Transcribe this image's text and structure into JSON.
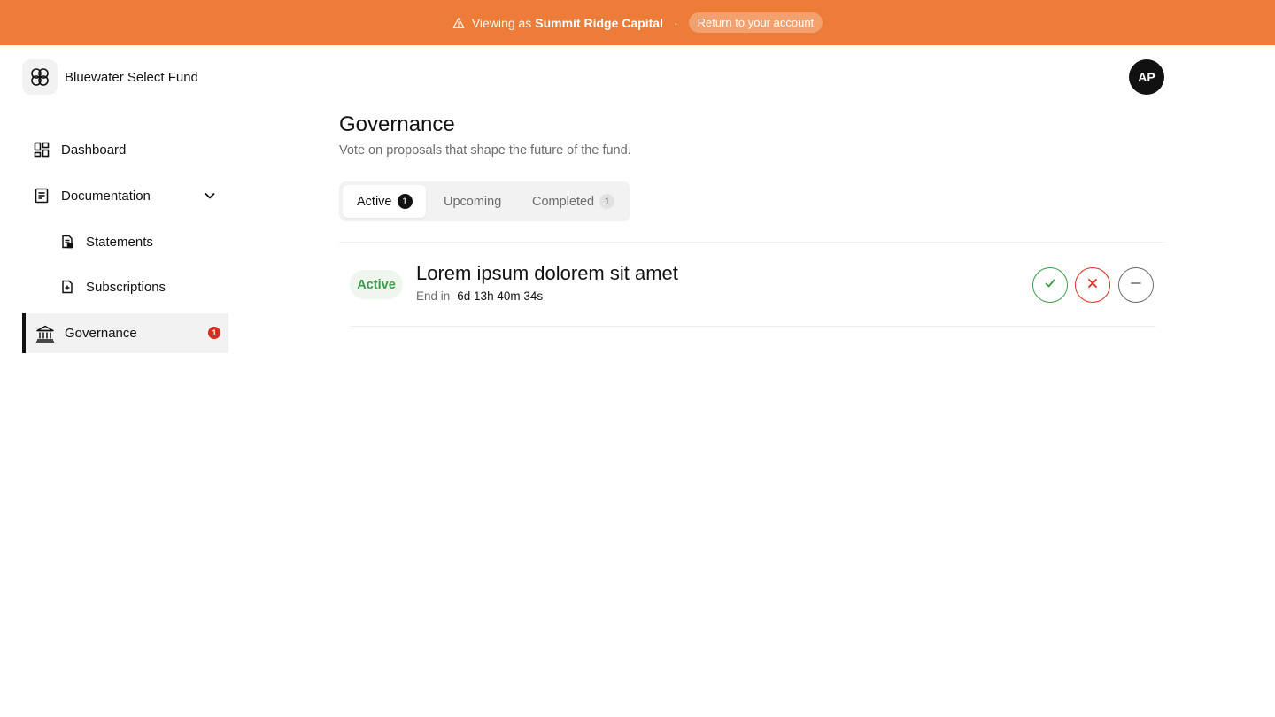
{
  "banner": {
    "viewing_label": "Viewing as",
    "org_name": "Summit Ridge Capital",
    "separator": "·",
    "return_label": "Return to your account",
    "color": "#ec7c37",
    "icon": "warning-icon"
  },
  "header": {
    "brand_name": "Bluewater Select Fund",
    "avatar_initials": "AP"
  },
  "sidebar": {
    "items": [
      {
        "label": "Dashboard",
        "icon": "dashboard-icon"
      },
      {
        "label": "Documentation",
        "icon": "document-icon",
        "expanded": true
      },
      {
        "label": "Statements",
        "icon": "statements-icon"
      },
      {
        "label": "Subscriptions",
        "icon": "subscriptions-icon"
      },
      {
        "label": "Governance",
        "icon": "bank-icon",
        "active": true,
        "badge": "1"
      }
    ]
  },
  "main": {
    "title": "Governance",
    "subtitle": "Vote on proposals that shape the future of the fund.",
    "tabs": [
      {
        "label": "Active",
        "count": "1",
        "selected": true
      },
      {
        "label": "Upcoming"
      },
      {
        "label": "Completed",
        "count": "1"
      }
    ],
    "proposals": [
      {
        "status": "Active",
        "title": "Lorem ipsum dolorem sit amet",
        "end_label": "End in",
        "end_time": "6d 13h 40m 34s",
        "actions": [
          "approve-icon",
          "reject-icon",
          "abstain-icon"
        ]
      }
    ]
  },
  "colors": {
    "accent": "#ec7c37",
    "success": "#3c9a4a",
    "danger": "#d92d20",
    "neutral": "#6b6b6b"
  }
}
